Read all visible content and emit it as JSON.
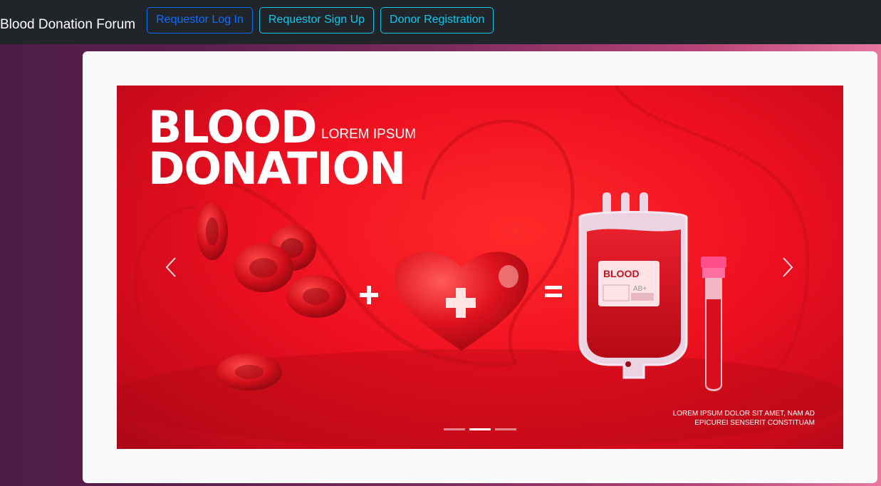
{
  "navbar": {
    "brand": "Blood Donation Forum",
    "buttons": [
      {
        "label": "Requestor Log In"
      },
      {
        "label": "Requestor Sign Up"
      },
      {
        "label": "Donor Registration"
      }
    ]
  },
  "carousel": {
    "slide": {
      "headline_line1": "BLOOD",
      "headline_line2": "DONATION",
      "subhead": "LOREM IPSUM",
      "bag_label": "BLOOD",
      "bag_type": "AB+",
      "footnote_line1": "LOREM IPSUM DOLOR SIT AMET, NAM AD",
      "footnote_line2": "EPICUREI SENSERIT CONSTITUAM"
    },
    "indicators_count": 3,
    "active_index": 1,
    "controls": {
      "prev_icon": "chevron-left-icon",
      "next_icon": "chevron-right-icon"
    }
  },
  "colors": {
    "navbar_bg": "#212529",
    "primary": "#0d6efd",
    "info": "#0dcaf0",
    "slide_red": "#ef1020"
  }
}
